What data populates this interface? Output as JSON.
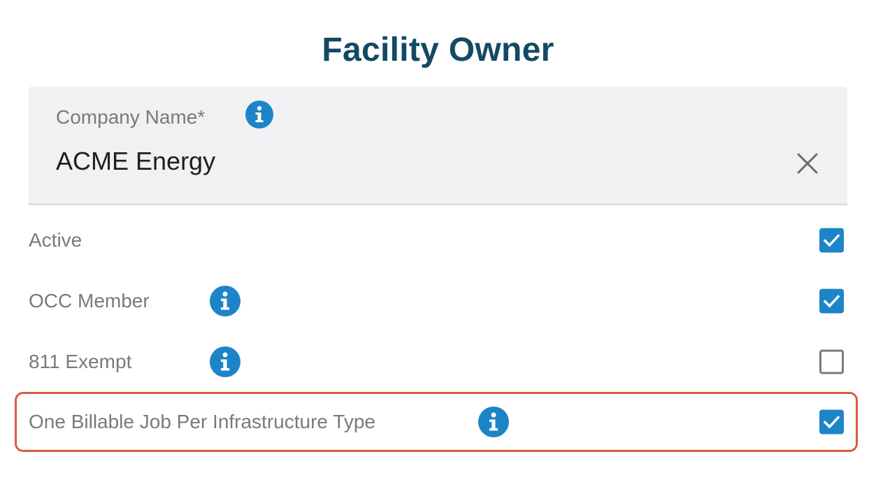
{
  "header": {
    "title": "Facility Owner"
  },
  "company": {
    "label": "Company Name*",
    "value": "ACME Energy",
    "info_icon": "info-circle-icon",
    "clear_icon": "close-icon"
  },
  "rows": [
    {
      "label": "Active",
      "checked": true,
      "has_info": false
    },
    {
      "label": "OCC Member",
      "checked": true,
      "has_info": true
    },
    {
      "label": "811 Exempt",
      "checked": false,
      "has_info": true
    },
    {
      "label": "One Billable Job Per Infrastructure Type",
      "checked": true,
      "has_info": true,
      "highlighted": true
    }
  ],
  "colors": {
    "title": "#134a63",
    "accent": "#1d84c8",
    "highlight_border": "#d95b43",
    "field_bg": "#f1f1f3"
  }
}
